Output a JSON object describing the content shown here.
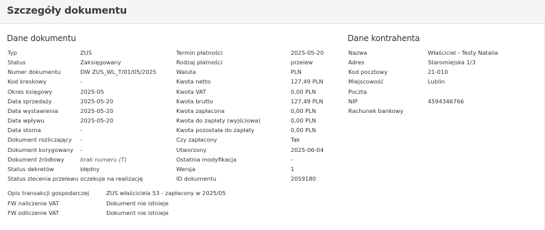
{
  "header": {
    "title": "Szczegóły dokumentu"
  },
  "sections": {
    "document_title": "Dane dokumentu",
    "contractor_title": "Dane kontrahenta"
  },
  "doc_left": [
    {
      "label": "Typ",
      "value": "ZUS"
    },
    {
      "label": "Status",
      "value": "Zaksięgowany"
    },
    {
      "label": "Numer dokumentu",
      "value": "DW ZUS_WL_T/01/05/2025"
    },
    {
      "label": "Kod kreskowy",
      "value": "-"
    },
    {
      "label": "Okres księgowy",
      "value": "2025-05"
    },
    {
      "label": "Data sprzedaży",
      "value": "2025-05-20"
    },
    {
      "label": "Data wystawienia",
      "value": "2025-05-20"
    },
    {
      "label": "Data wpływu",
      "value": "2025-05-20"
    },
    {
      "label": "Data storna",
      "value": "-"
    },
    {
      "label": "Dokument rozliczający",
      "value": "-"
    },
    {
      "label": "Dokument korygowany",
      "value": "-"
    },
    {
      "label": "Dokument źródłowy",
      "value": "brak numeru (T)"
    },
    {
      "label": "Status dekretów",
      "value": "błędny"
    },
    {
      "label": "Status zlecenia przelewu",
      "value": "oczekuje na realizację"
    }
  ],
  "doc_right": [
    {
      "label": "Termin płatności",
      "value": "2025-05-20"
    },
    {
      "label": "Rodzaj płatności",
      "value": "przelew"
    },
    {
      "label": "Waluta",
      "value": "PLN"
    },
    {
      "label": "Kwota netto",
      "value": "127,49 PLN"
    },
    {
      "label": "Kwota VAT",
      "value": "0,00 PLN"
    },
    {
      "label": "Kwota brutto",
      "value": "127,49 PLN"
    },
    {
      "label": "Kwota zapłacona",
      "value": "0,00 PLN"
    },
    {
      "label": "Kwota do zapłaty (wyjściowa)",
      "value": "0,00 PLN"
    },
    {
      "label": "Kwota pozostała do zapłaty",
      "value": "0,00 PLN"
    },
    {
      "label": "Czy zapłacony",
      "value": "Tak"
    },
    {
      "label": "Utworzony",
      "value": "2025-06-04"
    },
    {
      "label": "Ostatnia modyfikacja",
      "value": "-"
    },
    {
      "label": "Wersja",
      "value": "1"
    },
    {
      "label": "ID dokumentu",
      "value": "2059180"
    }
  ],
  "contractor": [
    {
      "label": "Nazwa",
      "value": "Właściciel - Testy Natalia"
    },
    {
      "label": "Adres",
      "value": "Staromiejska 1/3"
    },
    {
      "label": "Kod pocztowy",
      "value": "21-010"
    },
    {
      "label": "Miejscowość",
      "value": "Lublin"
    },
    {
      "label": "Poczta",
      "value": ""
    },
    {
      "label": "NIP",
      "value": "4594346766"
    },
    {
      "label": "Rachunek bankowy",
      "value": ""
    }
  ],
  "extra": [
    {
      "label": "Opis transakcji gospodarczej",
      "value": "ZUS właściciela 53 - zapłacony w 2025/05"
    },
    {
      "label": "FW naliczenie VAT",
      "value": "Dokument nie istnieje"
    },
    {
      "label": "FW odliczenie VAT",
      "value": "Dokument nie istnieje"
    }
  ]
}
